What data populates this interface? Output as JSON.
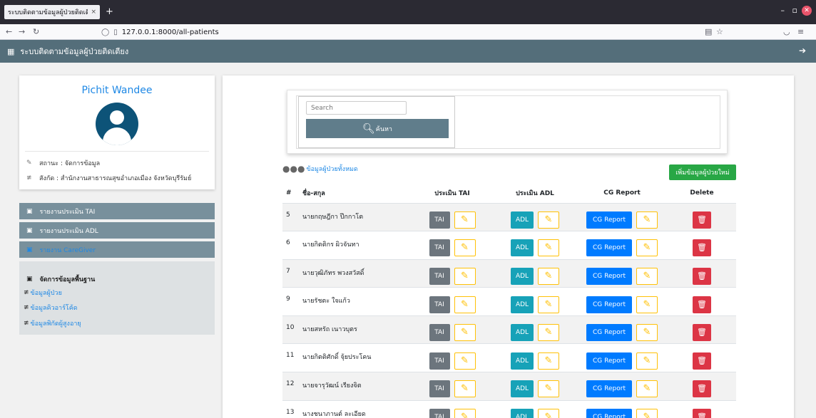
{
  "browser": {
    "tab_title": "ระบบติดตามข้อมูลผู้ป่วยติดเตี",
    "tab_close": "×",
    "new_tab": "+",
    "url": "127.0.0.1:8000/all-patients"
  },
  "navbar": {
    "title": "ระบบติดตามข้อมูลผู้ป่วยติดเตียง"
  },
  "profile": {
    "name": "Pichit Wandee",
    "status": "สถานะ : จัดการข้อมูล",
    "affiliation": "สังกัด : สำนักงานสาธารณสุขอำเภอเมือง จังหวัดบุรีรัมย์"
  },
  "sidebar": {
    "items": [
      {
        "label": "รายงานประเมิน TAI"
      },
      {
        "label": "รายงานประเมิน ADL"
      },
      {
        "label": "รายงาน CareGiver"
      }
    ],
    "manage": {
      "heading": "จัดการข้อมูลพื้นฐาน",
      "links": [
        {
          "label": "ข้อมูลผู้ป่วย"
        },
        {
          "label": "ข้อมูลคิวอาร์โค้ด"
        },
        {
          "label": "ข้อมูลพิกัดผู้สูงอายุ"
        }
      ]
    }
  },
  "search": {
    "placeholder": "Search",
    "button_label": "ค้นหา"
  },
  "list": {
    "title": "ข้อมูลผู้ป่วยทั้งหมด",
    "add_button": "เพิ่มข้อมูลผู้ป่วยใหม่"
  },
  "table": {
    "headers": [
      "#",
      "ชื่อ-สกุล",
      "ประเมิน TAI",
      "ประเมิน ADL",
      "CG Report",
      "Delete"
    ],
    "button_labels": {
      "tai": "TAI",
      "adl": "ADL",
      "cg": "CG Report"
    },
    "rows": [
      {
        "id": "5",
        "name": "นายกฤษฎีกา ปึกกาโต"
      },
      {
        "id": "6",
        "name": "นายกิตติกร ผิวจันทา"
      },
      {
        "id": "7",
        "name": "นายวุฒิภัทร พวงสวัสดิ์"
      },
      {
        "id": "9",
        "name": "นายรัชตะ ใจแก้ว"
      },
      {
        "id": "10",
        "name": "นายสหรัถ เนาวบุตร"
      },
      {
        "id": "11",
        "name": "นายกิตติศักดิ์ จุ้ยประโคน"
      },
      {
        "id": "12",
        "name": "นายจารุวัฒน์ เรียงจิต"
      },
      {
        "id": "13",
        "name": "นางชนาภานต์ ละเอียด"
      }
    ]
  },
  "colors": {
    "navbar": "#546e7a",
    "sidebar_item": "#78909c",
    "link": "#1e88e5",
    "add_button": "#28a745",
    "tai_button": "#6c757d",
    "adl_button": "#17a2b8",
    "cg_button": "#007bff",
    "edit_border": "#ffc107",
    "delete_button": "#dc3545"
  },
  "icons": {
    "brand": "grid-icon",
    "logout": "logout-icon",
    "status": "edit-icon",
    "affiliation": "sliders-icon",
    "sidebar_item": "id-card-icon",
    "search": "search-icon",
    "users": "users-icon",
    "edit": "edit-icon",
    "delete": "trash-icon"
  }
}
